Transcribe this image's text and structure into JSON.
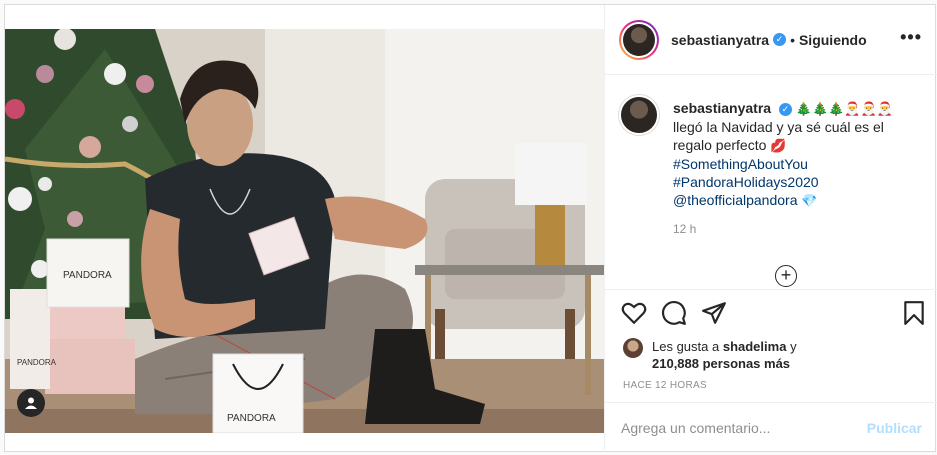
{
  "post": {
    "username": "sebastianyatra",
    "separator": "•",
    "follow_status": "Siguiendo",
    "more_label": "•••"
  },
  "caption": {
    "username": "sebastianyatra",
    "emojis": "🎄🎄🎄🎅🎅🎅",
    "text": "llegó la Navidad y ya sé cuál es el regalo perfecto",
    "lips_emoji": "💋",
    "hashtag1": "#SomethingAboutYou",
    "hashtag2": "#PandoraHolidays2020",
    "mention": "@theofficialpandora",
    "gem_emoji": "💎",
    "time": "12 h"
  },
  "likes": {
    "prefix": "Les gusta a",
    "user": "shadelima",
    "connector": "y",
    "count": "210,888 personas más"
  },
  "posted_ago": "HACE 12 HORAS",
  "comment": {
    "placeholder": "Agrega un comentario...",
    "publish_label": "Publicar"
  },
  "photo": {
    "bag_text_1": "PANDORA",
    "bag_text_2": "PANDORA",
    "bag_text_3": "PANDORA"
  },
  "colors": {
    "link": "#00376b",
    "muted": "#8e8e8e",
    "verified": "#3897f0",
    "publish_disabled": "#b2dffc"
  }
}
